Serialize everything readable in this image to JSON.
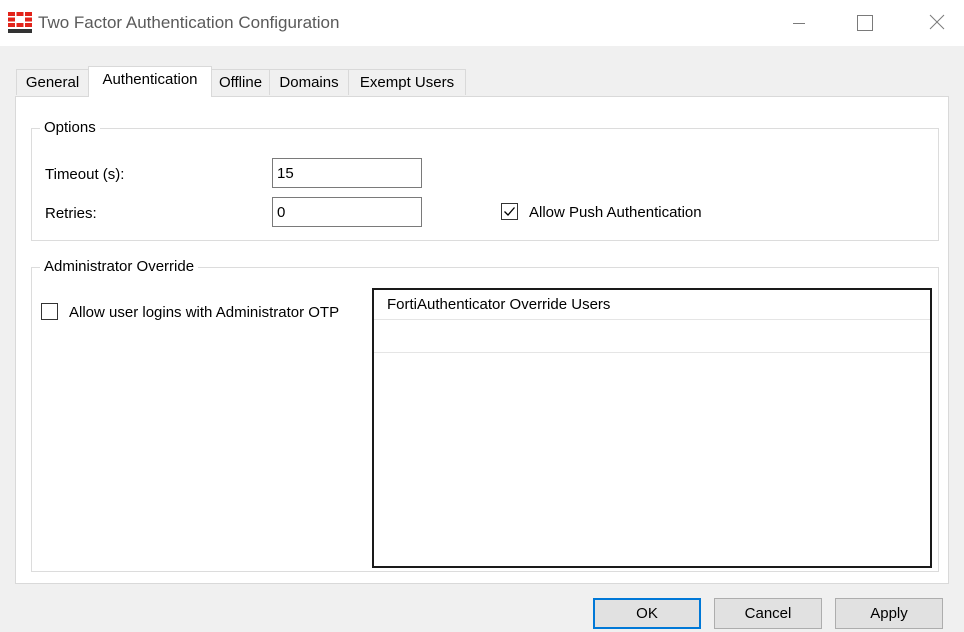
{
  "window": {
    "title": "Two Factor Authentication Configuration",
    "icon": "fortinet-logo-icon"
  },
  "tabs": [
    {
      "label": "General",
      "active": false
    },
    {
      "label": "Authentication",
      "active": true
    },
    {
      "label": "Offline",
      "active": false
    },
    {
      "label": "Domains",
      "active": false
    },
    {
      "label": "Exempt Users",
      "active": false
    }
  ],
  "options": {
    "legend": "Options",
    "timeout_label": "Timeout (s):",
    "timeout_value": "15",
    "retries_label": "Retries:",
    "retries_value": "0",
    "push_label": "Allow Push Authentication",
    "push_checked": true
  },
  "override": {
    "legend": "Administrator Override",
    "allow_otp_label": "Allow user logins with Administrator OTP",
    "allow_otp_checked": false,
    "list_header": "FortiAuthenticator Override Users",
    "list_rows": []
  },
  "buttons": {
    "ok": "OK",
    "cancel": "Cancel",
    "apply": "Apply"
  },
  "colors": {
    "accent": "#0078d7",
    "brand": "#e2231a"
  }
}
